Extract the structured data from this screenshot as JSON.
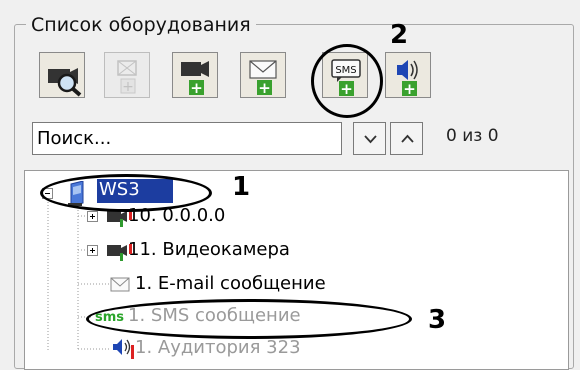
{
  "panel": {
    "title": "Список оборудования"
  },
  "toolbar": {
    "buttons": [
      {
        "name": "camera-search-icon"
      },
      {
        "name": "add-disabled-icon"
      },
      {
        "name": "add-camera-icon"
      },
      {
        "name": "add-email-icon"
      },
      {
        "name": "add-sms-icon",
        "label": "SMS"
      },
      {
        "name": "add-audio-icon"
      }
    ]
  },
  "search": {
    "value": "Поиск...",
    "counter": "0 из 0"
  },
  "tree": {
    "root": "WS3",
    "items": [
      {
        "label": "10. 0.0.0.0",
        "icon": "camera-icon"
      },
      {
        "label": "11. Видеокамера",
        "icon": "camera-icon"
      },
      {
        "label": "1. E-mail сообщение",
        "icon": "email-icon"
      },
      {
        "label": "1. SMS сообщение",
        "icon_text": "sms"
      },
      {
        "label": "1. Аудитория 323",
        "icon": "speaker-icon"
      }
    ]
  },
  "annotations": {
    "one": "1",
    "two": "2",
    "three": "3"
  }
}
